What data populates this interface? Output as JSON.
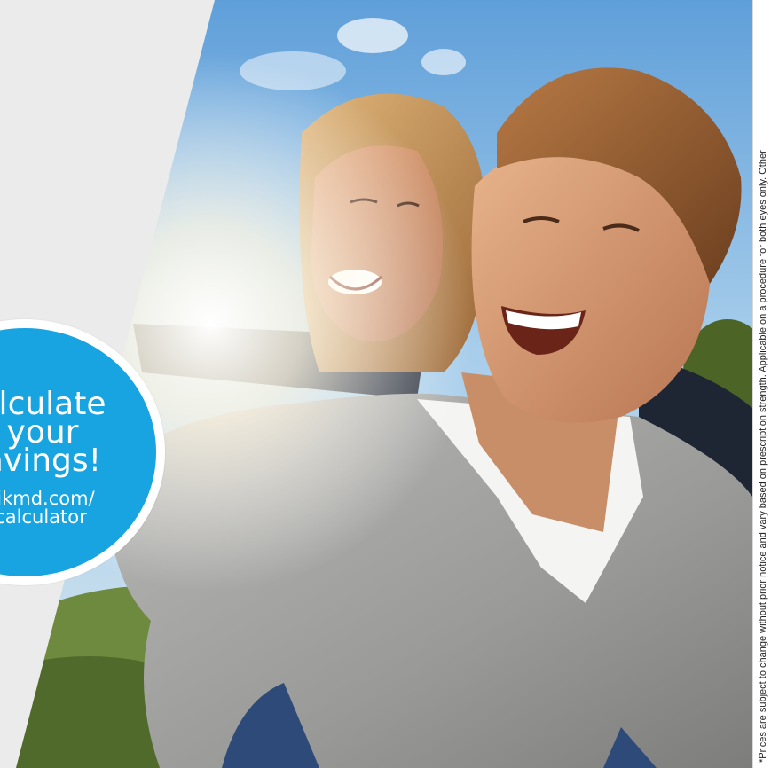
{
  "badge": {
    "title_lines": [
      "alculate",
      "your",
      "avings!"
    ],
    "url_lines": [
      "sikmd.com/",
      "calculator"
    ]
  },
  "disclaimer": "*Prices are subject to change without prior notice and vary based on prescription strength. Applicable on a procedure for both eyes only. Other",
  "colors": {
    "badge_fill": "#18a4e0",
    "panel_gray": "#ebebeb",
    "sky": "#8ec3e8"
  }
}
